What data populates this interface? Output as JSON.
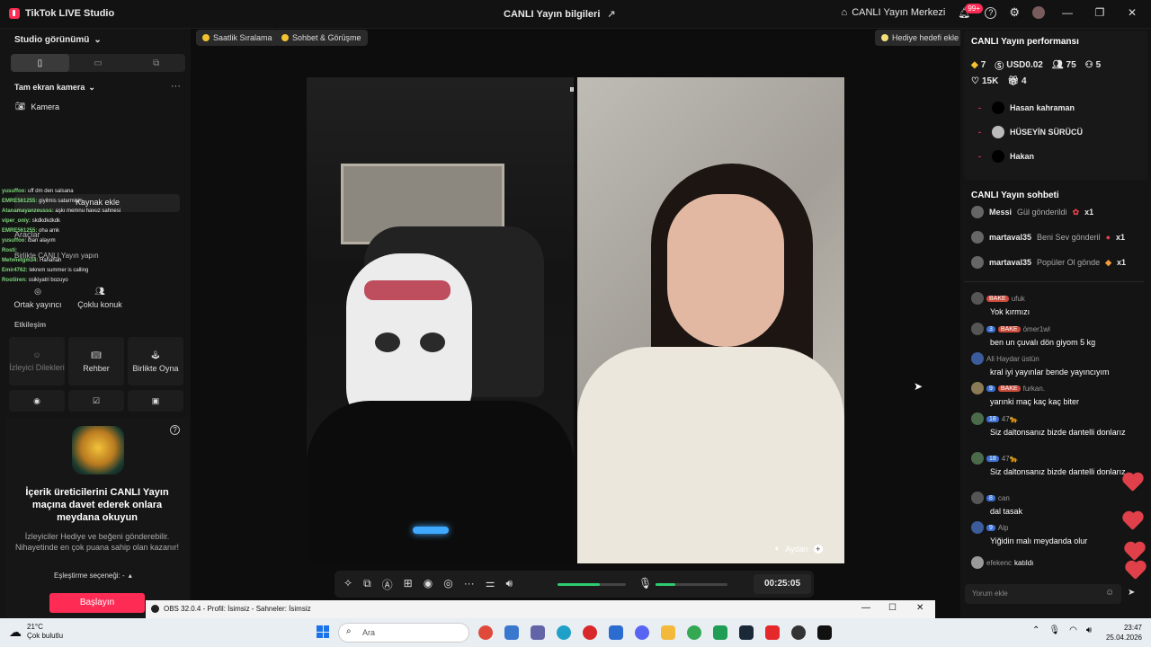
{
  "titlebar": {
    "app_name": "TikTok LIVE Studio",
    "center_title": "CANLI Yayın bilgileri",
    "center_link": "CANLI Yayın Merkezi",
    "notification_count": "99+"
  },
  "left": {
    "studio_view": "Studio görünümü",
    "scene_label": "Tam ekran kamera",
    "camera_source": "Kamera",
    "add_source_label": "Kaynak ekle",
    "tools_label": "Araçlar",
    "live_together_label": "Birlikte CANLI Yayın yapın",
    "tools": [
      {
        "label": "Ortak yayıncı"
      },
      {
        "label": "Çoklu konuk"
      }
    ],
    "interaction_label": "Etkileşim",
    "interaction_tools": [
      {
        "label": "İzleyici Dilekleri"
      },
      {
        "label": "Rehber"
      },
      {
        "label": "Birlikte Oyna"
      }
    ],
    "invite_title": "İçerik üreticilerini CANLI Yayın maçına davet ederek onlara meydana okuyun",
    "invite_desc": "İzleyiciler Hediye ve beğeni gönderebilir. Nihayetinde en çok puana sahip olan kazanır!",
    "match_option": "Eşleştirme seçeneği: -",
    "start_button": "Başlayın",
    "overlay_chat": [
      {
        "user": "yusuffoo:",
        "text": "uff dm den salsana"
      },
      {
        "user": "EMRE561255:",
        "text": "giyilmis satarmisin"
      },
      {
        "user": "Atanamayanzeusss:",
        "text": "aşkı memnu havuz sahnesi"
      },
      {
        "user": "viper_oniy:",
        "text": "skdkdkdkdk"
      },
      {
        "user": "EMRE561255:",
        "text": "oha amk"
      },
      {
        "user": "yusuffoo:",
        "text": "iban alayım"
      },
      {
        "user": "Rosti:",
        "text": ""
      },
      {
        "user": "Mehmetgm34:",
        "text": "Hahahah"
      },
      {
        "user": "Emir4762:",
        "text": "lekrem summer is calling"
      },
      {
        "user": "Rostiiren:",
        "text": "ssikiyatri bozuyo"
      }
    ]
  },
  "stage": {
    "chip_ranking": "Saatlik Sıralama",
    "chip_chat": "Sohbet & Görüşme",
    "chip_gift_goal": "Hediye hedefi ekle",
    "guest_name": "Aydan",
    "timer": "00:25:05"
  },
  "right": {
    "perf_title": "CANLI Yayın performansı",
    "stats": {
      "diamonds": "7",
      "usd": "USD0.02",
      "viewers": "75",
      "new_followers": "5",
      "likes": "15K",
      "gifters": "4"
    },
    "top_gifters": [
      {
        "name": "Hasan kahraman"
      },
      {
        "name": "HÜSEYİN SÜRÜCÜ"
      },
      {
        "name": "Hakan"
      }
    ],
    "chat_title": "CANLI Yayın sohbeti",
    "gifts": [
      {
        "user": "Messi",
        "text": "Gül gönderildi",
        "count": "x1"
      },
      {
        "user": "martaval35",
        "text": "Beni Sev gönderil",
        "count": "x1"
      },
      {
        "user": "martaval35",
        "text": "Popüler Ol gönde",
        "count": "x1"
      }
    ],
    "messages": [
      {
        "level": "",
        "fan": "BAKE",
        "user": "ufuk",
        "text": "Yok kırmızı"
      },
      {
        "level": "3",
        "fan": "BAKE",
        "user": "ömer1wl",
        "text": "ben un çuvalı dön giyom 5 kg"
      },
      {
        "level": "",
        "fan": "",
        "user": "Ali Haydar üstün",
        "text": "kral iyi yayınlar bende yayıncıyım"
      },
      {
        "level": "9",
        "fan": "BAKE",
        "user": "furkan.",
        "text": "yarınki maç kaç kaç biter"
      },
      {
        "level": "18",
        "fan": "",
        "user": "47🐆",
        "text": "Siz daltonsanız bizde dantelli donlarız"
      },
      {
        "level": "18",
        "fan": "",
        "user": "47🐆",
        "text": "Siz daltonsanız bizde dantelli donlarız"
      },
      {
        "level": "8",
        "fan": "",
        "user": "can",
        "text": "dal tasak"
      },
      {
        "level": "9",
        "fan": "",
        "user": "Alp",
        "text": "Yiğidin malı meydanda olur"
      }
    ],
    "joined_user": "efekenc",
    "joined_text": "katıldı",
    "comment_placeholder": "Yorum ekle"
  },
  "obs": {
    "title": "OBS 32.0.4 - Profil: İsimsiz - Sahneler: İsimsiz"
  },
  "taskbar": {
    "temperature": "21°C",
    "weather": "Çok bulutlu",
    "search_placeholder": "Ara",
    "time": "23:47",
    "date": "25.04.2026"
  },
  "colors": {
    "accent": "#fe2c55",
    "green": "#2ecc71",
    "level_blue": "#3b6fd0"
  }
}
